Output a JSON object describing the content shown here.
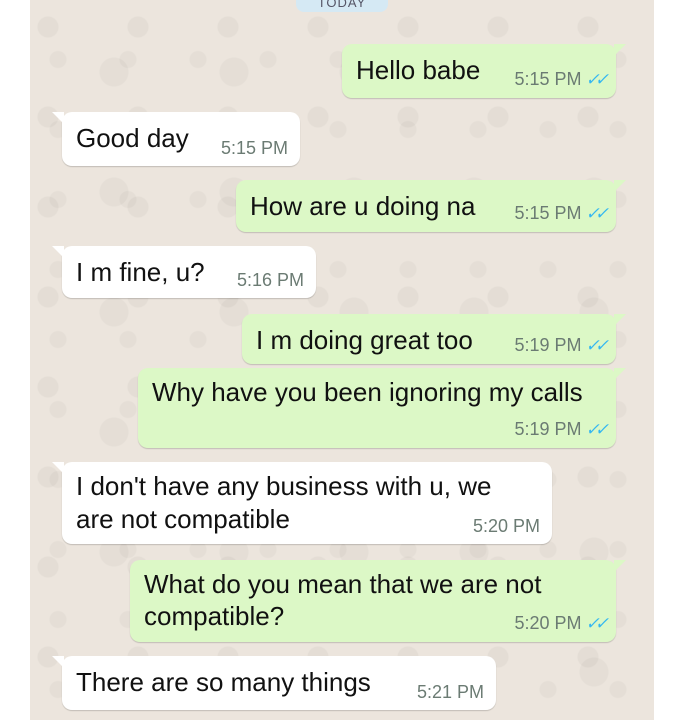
{
  "date_separator": "TODAY",
  "messages": [
    {
      "text": "Hello babe",
      "time": "5:15 PM",
      "dir": "out",
      "ticks": "✓✓"
    },
    {
      "text": "Good day",
      "time": "5:15 PM",
      "dir": "in"
    },
    {
      "text": "How are u doing na",
      "time": "5:15 PM",
      "dir": "out",
      "ticks": "✓✓"
    },
    {
      "text": "I m fine, u?",
      "time": "5:16 PM",
      "dir": "in"
    },
    {
      "text": "I m doing great too",
      "time": "5:19 PM",
      "dir": "out",
      "ticks": "✓✓"
    },
    {
      "text": "Why have you been ignoring my calls",
      "time": "5:19 PM",
      "dir": "out",
      "ticks": "✓✓"
    },
    {
      "text_line1": "I don't have any business with u, we",
      "text_line2": "are not compatible",
      "time": "5:20 PM",
      "dir": "in"
    },
    {
      "text_line1": "What do you mean that we are not",
      "text_line2": "compatible?",
      "time": "5:20 PM",
      "dir": "out",
      "ticks": "✓✓"
    },
    {
      "text": "There are so many things",
      "time": "5:21 PM",
      "dir": "in"
    }
  ],
  "colors": {
    "outgoing": "#dcf8c6",
    "incoming": "#ffffff",
    "background": "#ece5dd",
    "read_ticks": "#34b7f1"
  },
  "icons": {
    "read_receipt": "double-check-icon"
  }
}
